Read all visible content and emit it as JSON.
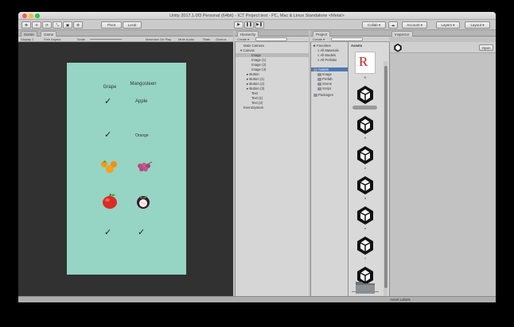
{
  "window": {
    "title": "Unity 2017.1.0f3 Personal (64bit) - ICT Project test - PC, Mac & Linux Standalone <Metal>"
  },
  "toolbar": {
    "tools": [
      "✥",
      "✛",
      "⟳",
      "⤡",
      "▣",
      "⚙"
    ],
    "pivot_label": "Pivot",
    "local_label": "Local",
    "play": "▶",
    "pause": "❚❚",
    "step": "▶❚",
    "collab_label": "Collab ▾",
    "cloud_icon": "cloud",
    "account_label": "Account ▾",
    "layers_label": "Layers ▾",
    "layout_label": "Layout ▾"
  },
  "tabs": {
    "scene": "Scene",
    "game": "Game",
    "hierarchy": "Hierarchy",
    "project": "Project",
    "inspector": "Inspector"
  },
  "game_subbar": {
    "display": "Display 1",
    "aspect": "Free Aspect",
    "scale": "Scale",
    "maximize": "Maximize On Play",
    "mute": "Mute Audio",
    "stats": "Stats",
    "gizmos": "Gizmos"
  },
  "hierarchy": {
    "create_label": "Create ▾",
    "rows": [
      "Main Camera",
      "Canvas",
      "Image",
      "Image (1)",
      "Image (2)",
      "Image (3)",
      "Button",
      "Button (1)",
      "Button (2)",
      "Button (3)",
      "Text",
      "Text (1)",
      "Text (2)",
      "EventSystem"
    ]
  },
  "project": {
    "create_label": "Create ▾",
    "favorites": [
      "Favorites",
      "All Materials",
      "All Models",
      "All Prefabs"
    ],
    "assets_root": "Assets",
    "folders": [
      "Image",
      "Prefab",
      "Scene",
      "Script"
    ],
    "packages": "Packages",
    "breadcrumb": "Assets",
    "asset_labels": [
      "R",
      "a",
      "b",
      "c",
      "d",
      "e",
      "f",
      "g",
      "h",
      "i"
    ]
  },
  "inspector": {
    "open_label": "Open"
  },
  "game": {
    "headers": [
      "Grape",
      "Mangosteen"
    ],
    "texts": [
      "Apple",
      "Orange"
    ],
    "checks": [
      "✓",
      "✓",
      "✓",
      "✓",
      "✓"
    ]
  },
  "status": {
    "text": "Asset Labels"
  },
  "colors": {
    "game_bg": "#96d4c3",
    "viewport": "#313131",
    "selection": "#4b79b8"
  }
}
